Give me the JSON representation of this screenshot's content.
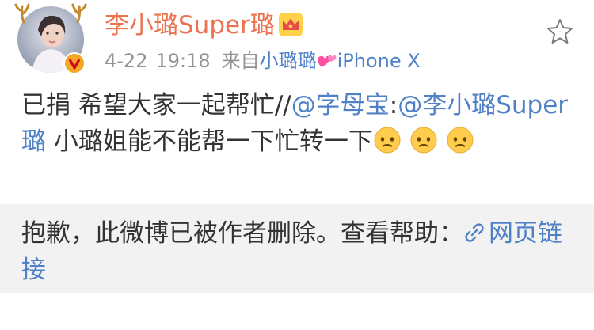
{
  "post": {
    "username": "李小璐Super璐",
    "date": "4-22",
    "time": "19:18",
    "from_label": "来自",
    "source_name": "小璐璐",
    "source_device": "iPhone X",
    "text_part1": "已捐 希望大家一起帮忙//",
    "mention_1": "@字母宝",
    "colon": ":",
    "mention_2": "@李小璐Super璐",
    "text_part2": "  小璐姐能不能帮一下忙转一下"
  },
  "repost": {
    "deleted_text": "抱歉，此微博已被作者删除。查看帮助：",
    "link_label": "网页链接"
  },
  "icons": {
    "crown": "crown-icon",
    "verify": "verified-badge-icon",
    "heart": "two-hearts-emoji",
    "star": "favorite-star-icon",
    "face": "worried-face-emoji",
    "link": "link-icon"
  },
  "colors": {
    "username": "#eb7350",
    "link": "#5081c7",
    "meta": "#939393",
    "repost_bg": "#f2f2f2"
  }
}
